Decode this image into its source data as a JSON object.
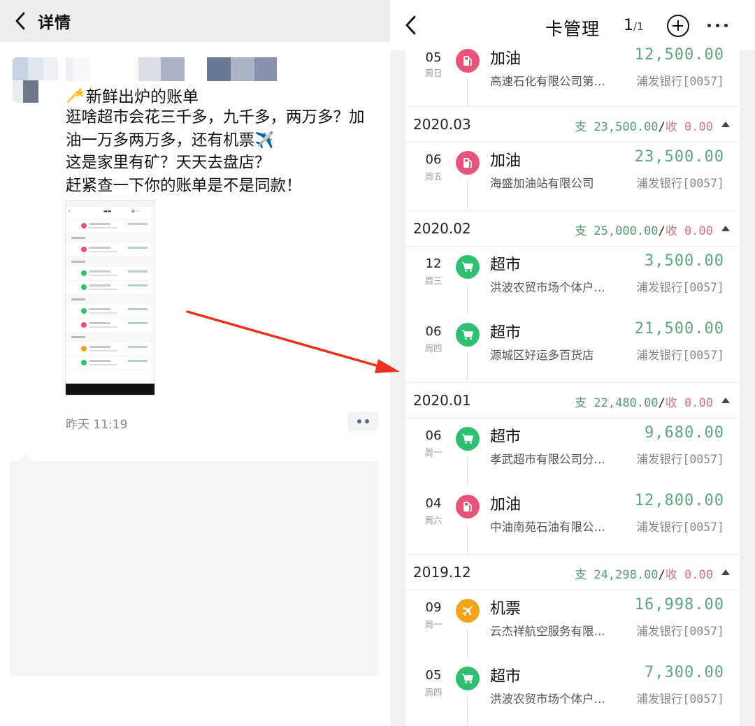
{
  "left": {
    "nav": {
      "title": "详情"
    },
    "post": {
      "first_line": "新鲜出炉的账单",
      "lines": [
        "逛啥超市会花三千多，九千多，两万多？加",
        "油一万多两万多，还有机票✈️",
        "这是家里有矿？天天去盘店？",
        "赶紧查一下你的账单是不是同款！"
      ],
      "time": "昨天 11:19"
    }
  },
  "right": {
    "nav": {
      "title": "卡管理",
      "page_current": "1",
      "page_total": "1"
    },
    "top_row": {
      "day": "05",
      "weekday": "周日",
      "category": "加油",
      "icon": "gas-pump-icon",
      "amount": "12,500.00",
      "merchant": "高速石化有限公司第…",
      "bank": "浦发银行[0057]"
    },
    "groups": [
      {
        "month": "2020.03",
        "pay_label": "支",
        "pay": "23,500.00",
        "sep": "/",
        "inc_label": "收",
        "inc": "0.00",
        "items": [
          {
            "day": "06",
            "weekday": "周五",
            "category": "加油",
            "icon": "gas-pump-icon",
            "amount": "23,500.00",
            "merchant": "海盛加油站有限公司",
            "bank": "浦发银行[0057]"
          }
        ]
      },
      {
        "month": "2020.02",
        "pay_label": "支",
        "pay": "25,000.00",
        "sep": "/",
        "inc_label": "收",
        "inc": "0.00",
        "items": [
          {
            "day": "12",
            "weekday": "周三",
            "category": "超市",
            "icon": "shopping-cart-icon",
            "amount": "3,500.00",
            "merchant": "洪波农贸市场个体户…",
            "bank": "浦发银行[0057]"
          },
          {
            "day": "06",
            "weekday": "周四",
            "category": "超市",
            "icon": "shopping-cart-icon",
            "amount": "21,500.00",
            "merchant": "源城区好运多百货店",
            "bank": "浦发银行[0057]"
          }
        ]
      },
      {
        "month": "2020.01",
        "pay_label": "支",
        "pay": "22,480.00",
        "sep": "/",
        "inc_label": "收",
        "inc": "0.00",
        "items": [
          {
            "day": "06",
            "weekday": "周一",
            "category": "超市",
            "icon": "shopping-cart-icon",
            "amount": "9,680.00",
            "merchant": "孝武超市有限公司分…",
            "bank": "浦发银行[0057]"
          },
          {
            "day": "04",
            "weekday": "周六",
            "category": "加油",
            "icon": "gas-pump-icon",
            "amount": "12,800.00",
            "merchant": "中油南苑石油有限公…",
            "bank": "浦发银行[0057]"
          }
        ]
      },
      {
        "month": "2019.12",
        "pay_label": "支",
        "pay": "24,298.00",
        "sep": "/",
        "inc_label": "收",
        "inc": "0.00",
        "items": [
          {
            "day": "09",
            "weekday": "周一",
            "category": "机票",
            "icon": "airplane-icon",
            "amount": "16,998.00",
            "merchant": "云杰祥航空服务有限…",
            "bank": "浦发银行[0057]"
          },
          {
            "day": "05",
            "weekday": "周四",
            "category": "超市",
            "icon": "shopping-cart-icon",
            "amount": "7,300.00",
            "merchant": "洪波农贸市场个体户…",
            "bank": "浦发银行[0057]"
          }
        ]
      }
    ]
  },
  "colors": {
    "gas": "#e8537a",
    "market": "#2fbf71",
    "flight": "#f2a417",
    "pay_green": "#5ca67c",
    "income_red": "#d9737e",
    "link_blue": "#56698f"
  }
}
